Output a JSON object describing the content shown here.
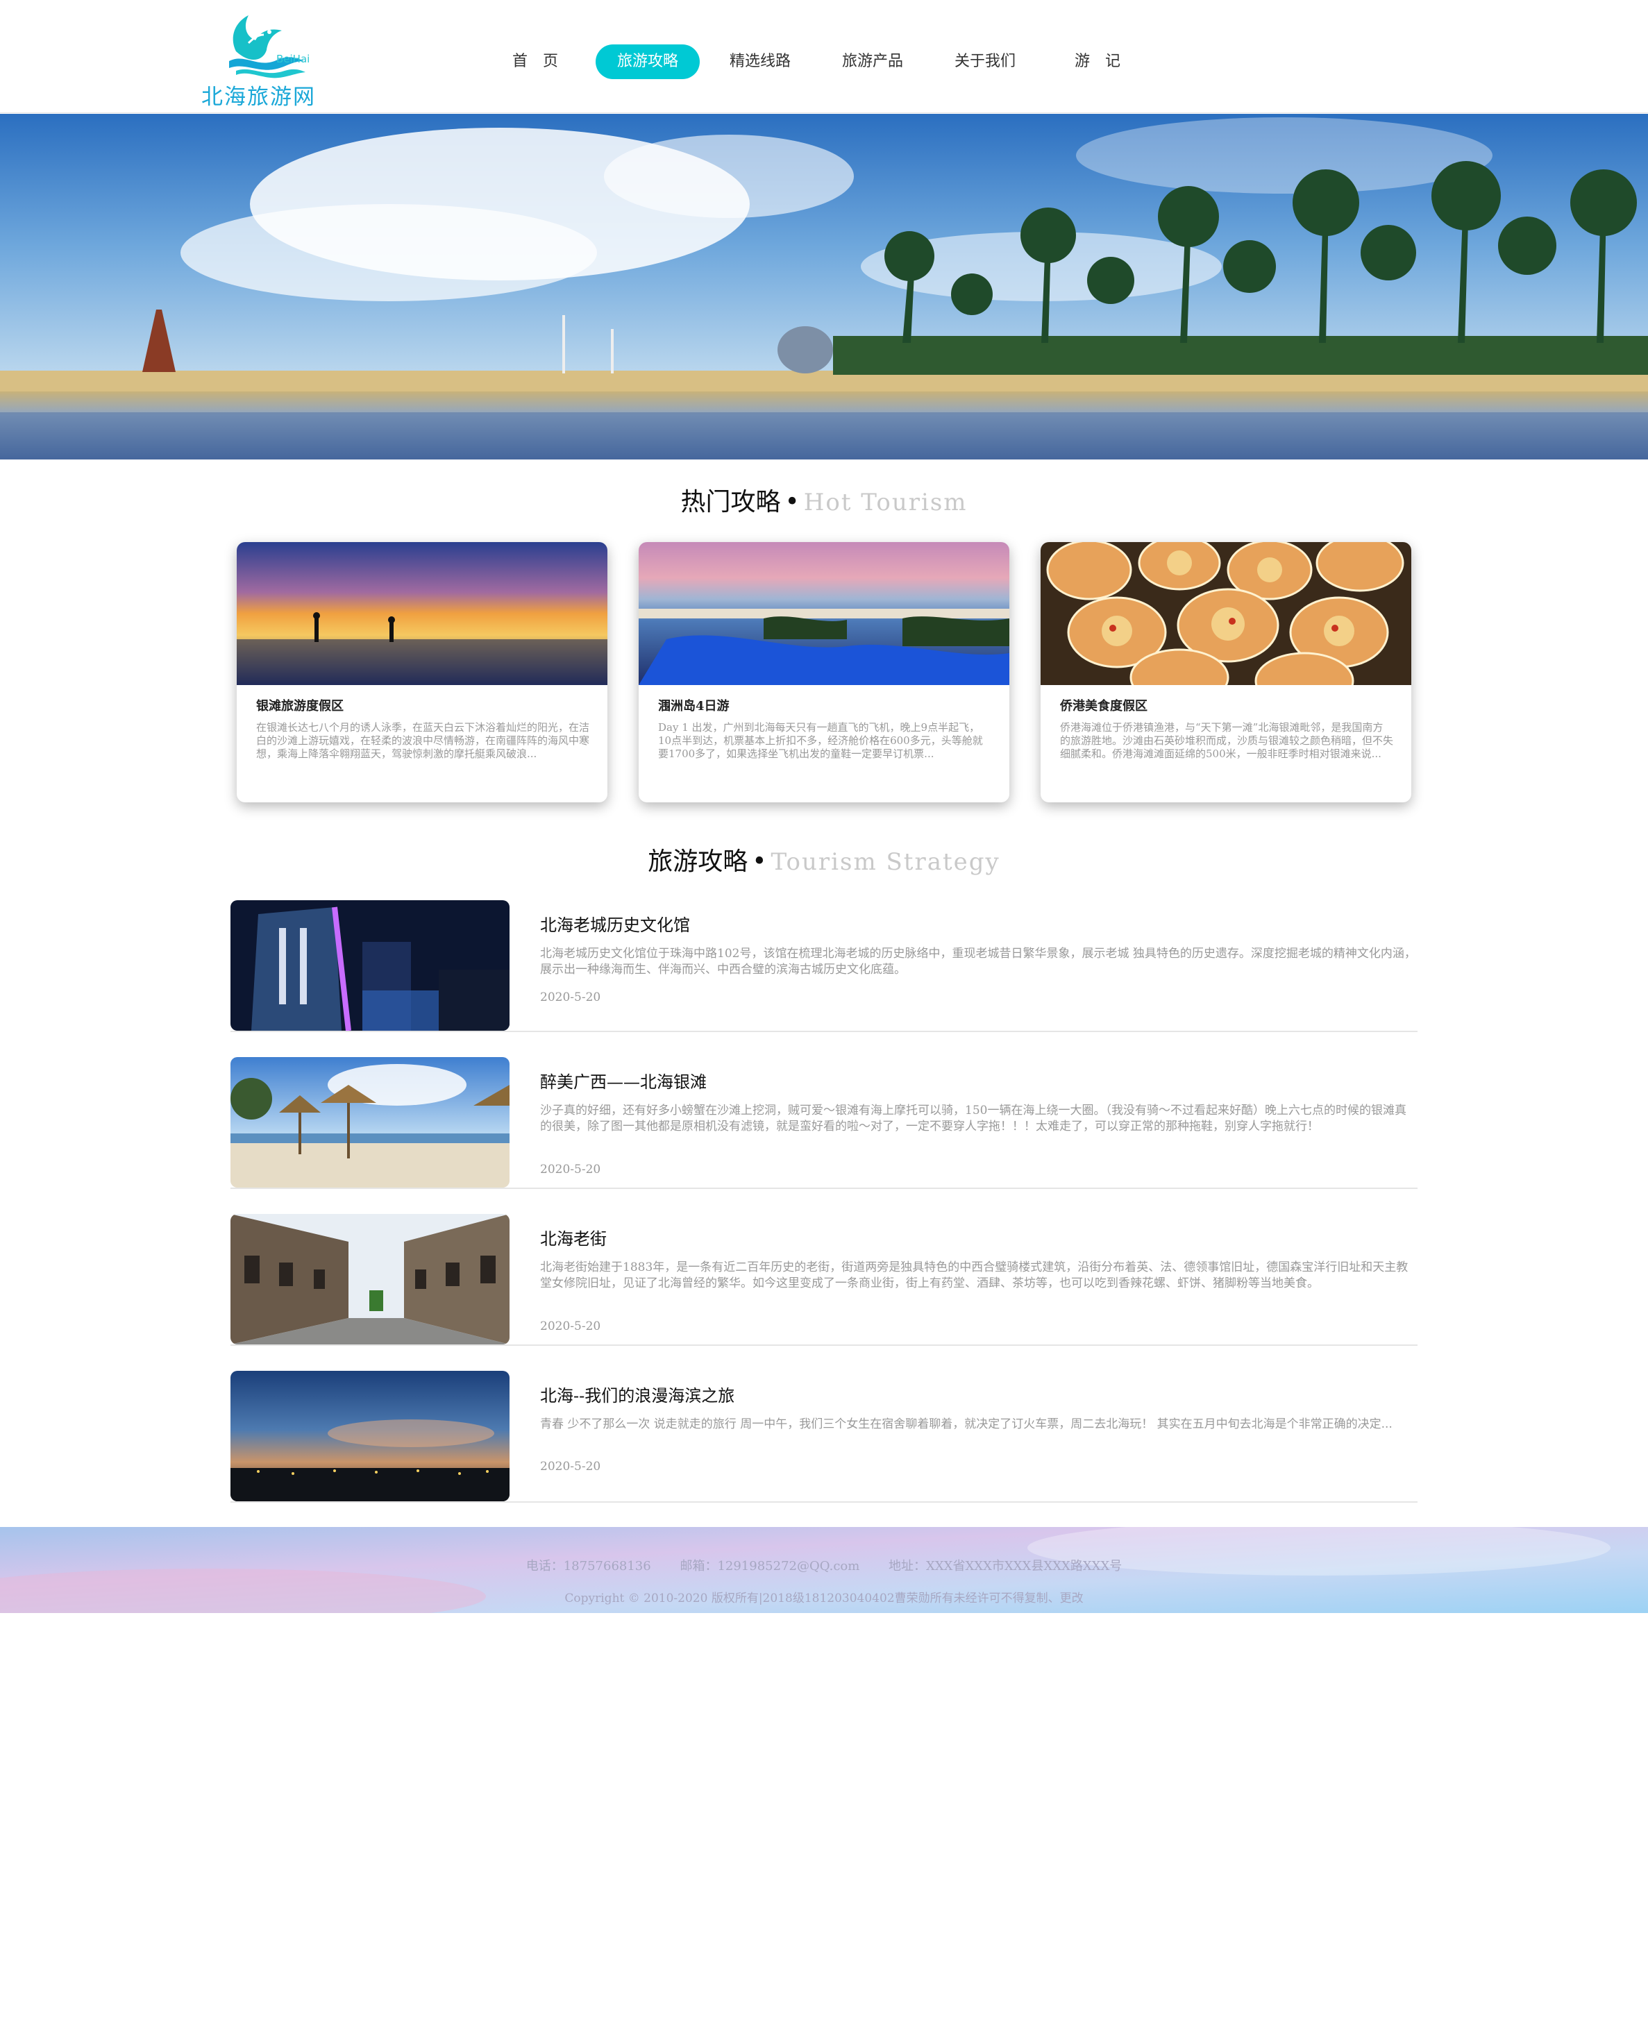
{
  "header": {
    "logo_en": "BeiHai",
    "logo_cn": "北海旅游网",
    "nav": [
      {
        "label": "首　页",
        "active": false
      },
      {
        "label": "旅游攻略",
        "active": true
      },
      {
        "label": "精选线路",
        "active": false
      },
      {
        "label": "旅游产品",
        "active": false
      },
      {
        "label": "关于我们",
        "active": false
      },
      {
        "label": "游　记",
        "active": false
      }
    ]
  },
  "hot": {
    "title_cn": "热门攻略",
    "dot": "•",
    "title_en": "Hot Tourism",
    "cards": [
      {
        "title": "银滩旅游度假区",
        "text": "在银滩长达七八个月的诱人泳季，在蓝天白云下沐浴着灿烂的阳光，在洁白的沙滩上游玩嬉戏，在轻柔的波浪中尽情畅游，在南疆阵阵的海风中寒想，乘海上降落伞翱翔蓝天，驾驶惊刺激的摩托艇乘风破浪..."
      },
      {
        "title": "涠洲岛4日游",
        "text": "Day 1 出发，广州到北海每天只有一趟直飞的飞机，晚上9点半起飞，10点半到达，机票基本上折扣不多，经济舱价格在600多元，头等舱就要1700多了，如果选择坐飞机出发的童鞋一定要早订机票..."
      },
      {
        "title": "侨港美食度假区",
        "text": "侨港海滩位于侨港镇渔港，与“天下第一滩”北海银滩毗邻，是我国南方的旅游胜地。沙滩由石英砂堆积而成，沙质与银滩较之颜色稍暗，但不失细腻柔和。侨港海滩滩面延绵的500米，一般非旺季时相对银滩来说..."
      }
    ]
  },
  "strategy": {
    "title_cn": "旅游攻略",
    "dot": "•",
    "title_en": "Tourism Strategy",
    "articles": [
      {
        "title": "北海老城历史文化馆",
        "text": "北海老城历史文化馆位于珠海中路102号，该馆在梳理北海老城的历史脉络中，重现老城昔日繁华景象，展示老城 独具特色的历史遗存。深度挖掘老城的精神文化内涵，展示出一种缘海而生、伴海而兴、中西合璧的滨海古城历史文化底蕴。",
        "date": "2020-5-20"
      },
      {
        "title": "醉美广西——北海银滩",
        "text": "沙子真的好细，还有好多小螃蟹在沙滩上挖洞，贼可爱～银滩有海上摩托可以骑，150一辆在海上绕一大圈。（我没有骑～不过看起来好酷）晚上六七点的时候的银滩真的很美，除了图一其他都是原相机没有滤镜，就是蛮好看的啦～对了，一定不要穿人字拖！！！太难走了，可以穿正常的那种拖鞋，别穿人字拖就行！",
        "date": "2020-5-20"
      },
      {
        "title": "北海老街",
        "text": "北海老街始建于1883年，是一条有近二百年历史的老街，街道两旁是独具特色的中西合璧骑楼式建筑，沿街分布着英、法、德领事馆旧址，德国森宝洋行旧址和天主教堂女修院旧址，见证了北海曾经的繁华。如今这里变成了一条商业街，街上有药堂、酒肆、茶坊等，也可以吃到香辣花螺、虾饼、猪脚粉等当地美食。",
        "date": "2020-5-20"
      },
      {
        "title": "北海--我们的浪漫海滨之旅",
        "text": "青春 少不了那么一次 说走就走的旅行 周一中午，我们三个女生在宿舍聊着聊着，就决定了订火车票，周二去北海玩！ 其实在五月中旬去北海是个非常正确的决定...",
        "date": "2020-5-20"
      }
    ]
  },
  "footer": {
    "phone": "电话：18757668136",
    "email": "邮箱：1291985272@QQ.com",
    "address": "地址：XXX省XXX市XXX县XXX路XXX号",
    "copyright": "Copyright © 2010-2020 版权所有|2018级181203040402曹荣勋所有未经许可不得复制、更改"
  },
  "colors": {
    "accent": "#00c9d4",
    "logo_blue": "#1ba8d8",
    "muted_text": "#999999",
    "footer_text": "#a7a7c2"
  }
}
